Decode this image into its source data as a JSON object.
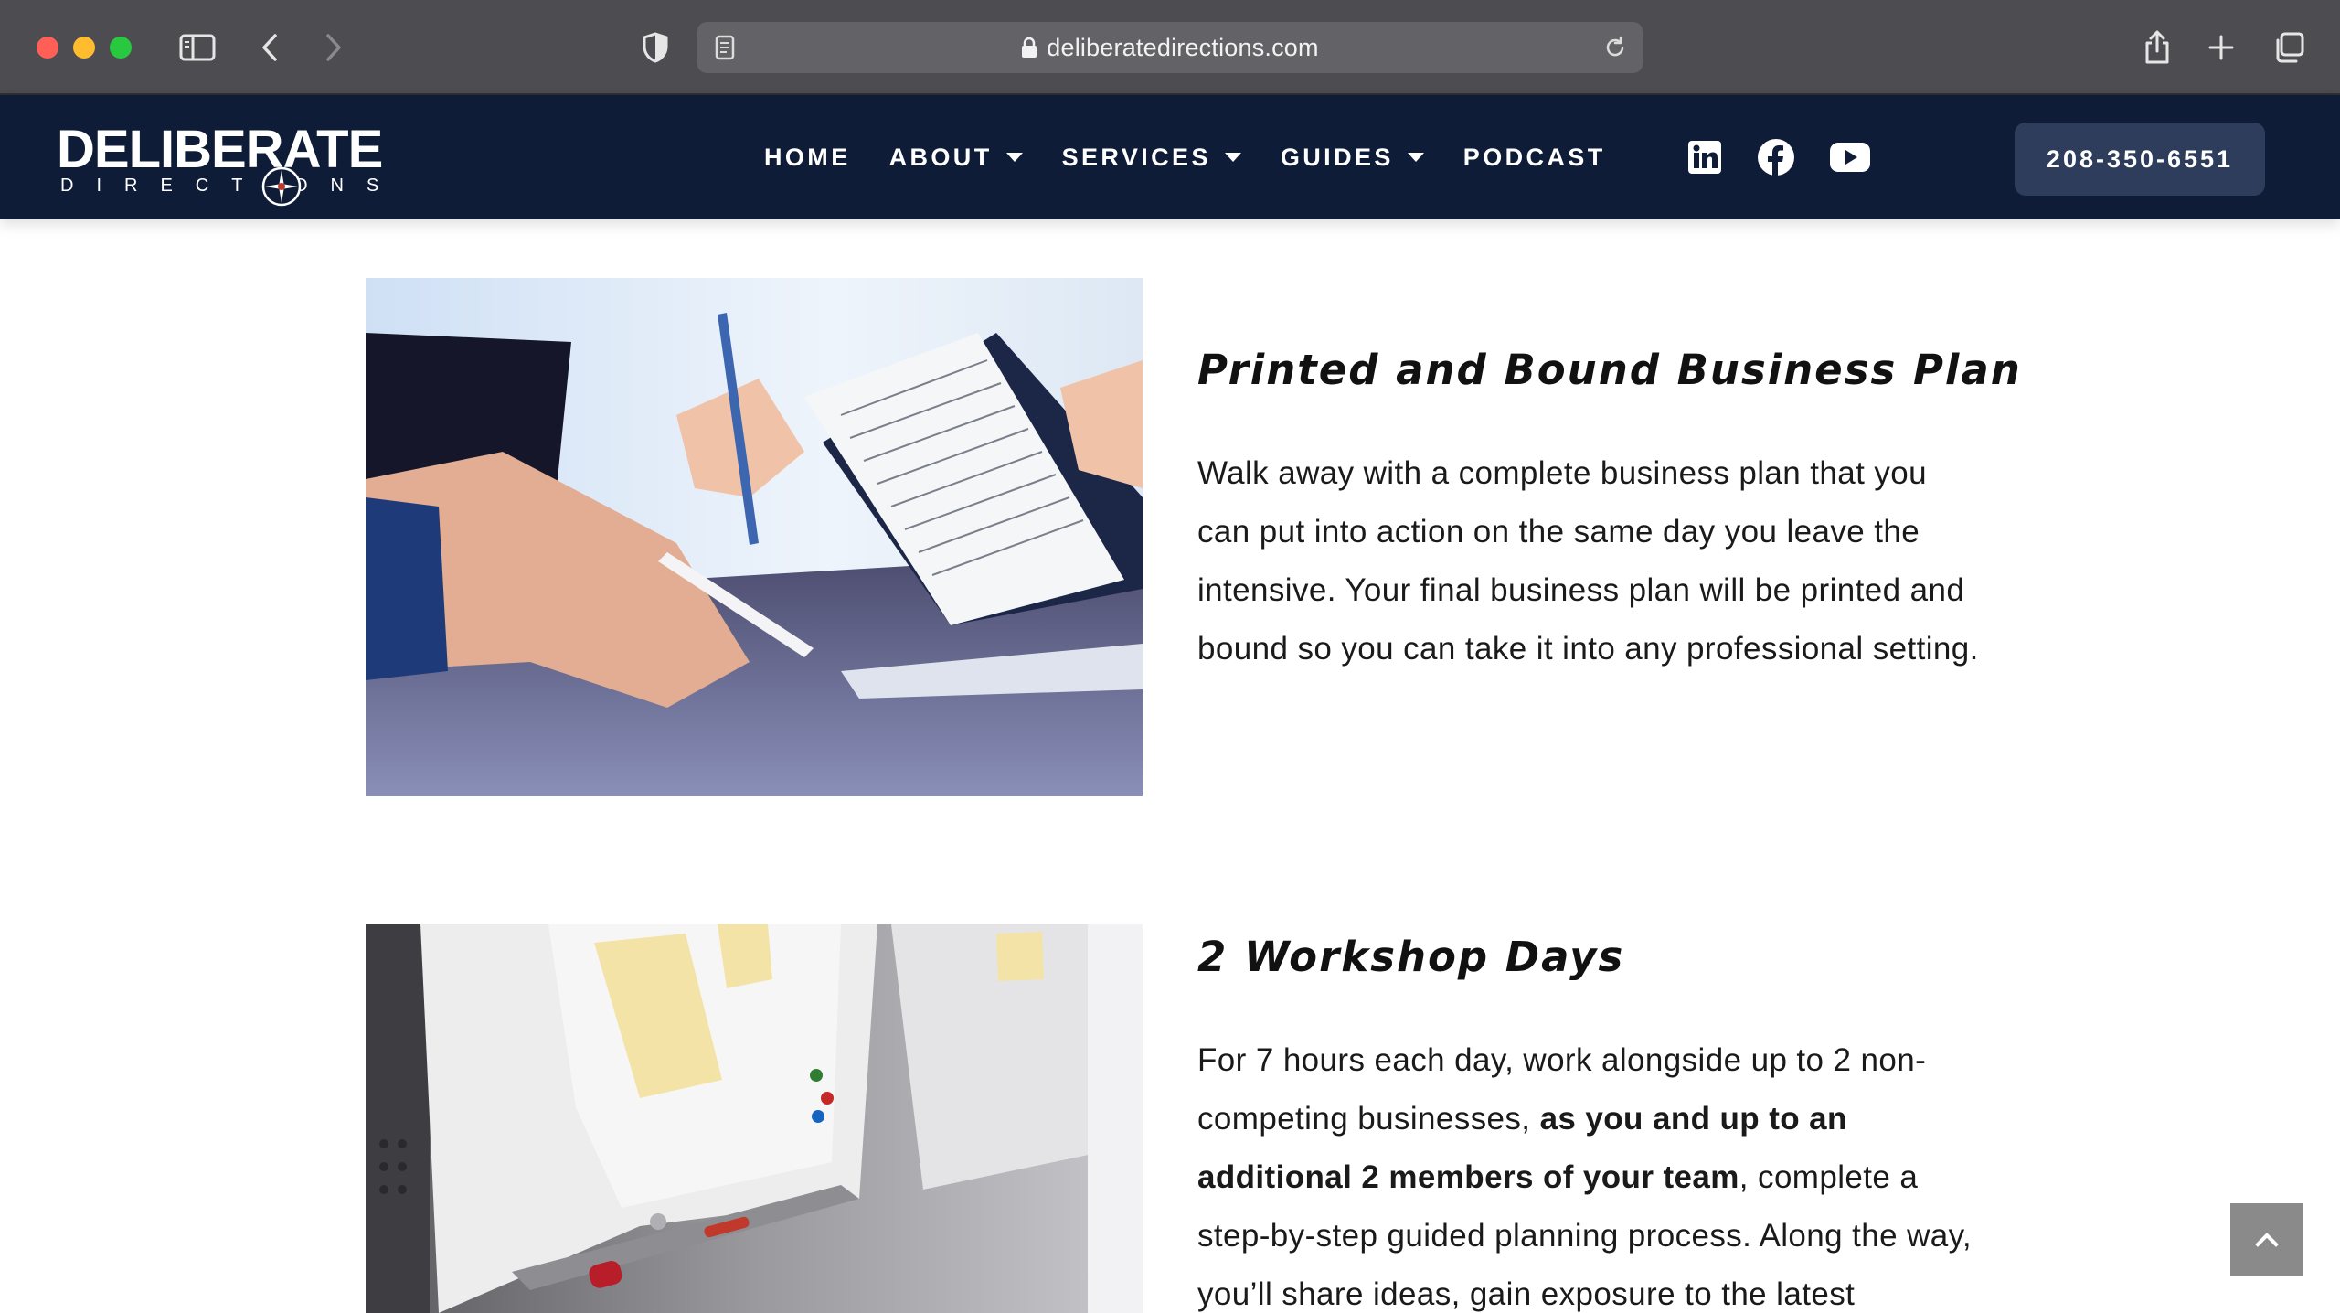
{
  "browser": {
    "url": "deliberatedirections.com",
    "icons": [
      "sidebar-icon",
      "back-icon",
      "forward-icon",
      "privacy-shield-icon",
      "reader-icon",
      "lock-icon",
      "reload-icon",
      "share-icon",
      "new-tab-icon",
      "tab-overview-icon"
    ]
  },
  "header": {
    "logo_main": "DELIBERATE",
    "logo_sub": "DIRECTIONS",
    "nav": [
      {
        "label": "HOME",
        "has_dropdown": false
      },
      {
        "label": "ABOUT",
        "has_dropdown": true
      },
      {
        "label": "SERVICES",
        "has_dropdown": true
      },
      {
        "label": "GUIDES",
        "has_dropdown": true
      },
      {
        "label": "PODCAST",
        "has_dropdown": false
      }
    ],
    "social": [
      "linkedin-icon",
      "facebook-icon",
      "youtube-icon"
    ],
    "phone": "208-350-6551",
    "colors": {
      "header_bg": "#0f1c38",
      "button_bg": "#2f3d5c"
    }
  },
  "sections": [
    {
      "title": "Printed and Bound Business Plan",
      "body": "Walk away with a complete business plan that you can put into action on the same day you leave the intensive. Your final business plan will be printed and bound so you can take it into any professional setting."
    },
    {
      "title": "2 Workshop Days",
      "body_pre": "For 7 hours each day, work alongside up to 2 non-competing businesses, ",
      "body_bold": "as you and up to an additional 2 members of your team",
      "body_post": ", complete a step-by-step guided planning process. Along the way, you’ll share ideas, gain exposure to the latest"
    }
  ],
  "scroll_top_icon": "chevron-up-icon"
}
